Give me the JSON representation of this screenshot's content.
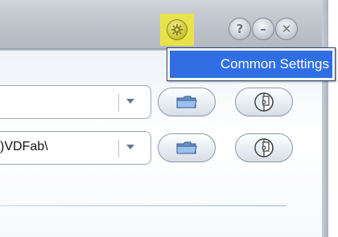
{
  "titlebar": {
    "settings_icon": "gear-icon",
    "help_label": "?",
    "minimize_label": "–",
    "close_label": "✕",
    "highlight_color": "#e8e34a"
  },
  "menu": {
    "items": [
      {
        "label": "Common Settings"
      }
    ],
    "highlight_color": "#2f6fe3"
  },
  "rows": [
    {
      "path": "",
      "open_icon": "folder-icon",
      "disc_icon": "disc-icon"
    },
    {
      "path": ")VDFab\\",
      "open_icon": "folder-icon",
      "disc_icon": "disc-icon"
    }
  ]
}
